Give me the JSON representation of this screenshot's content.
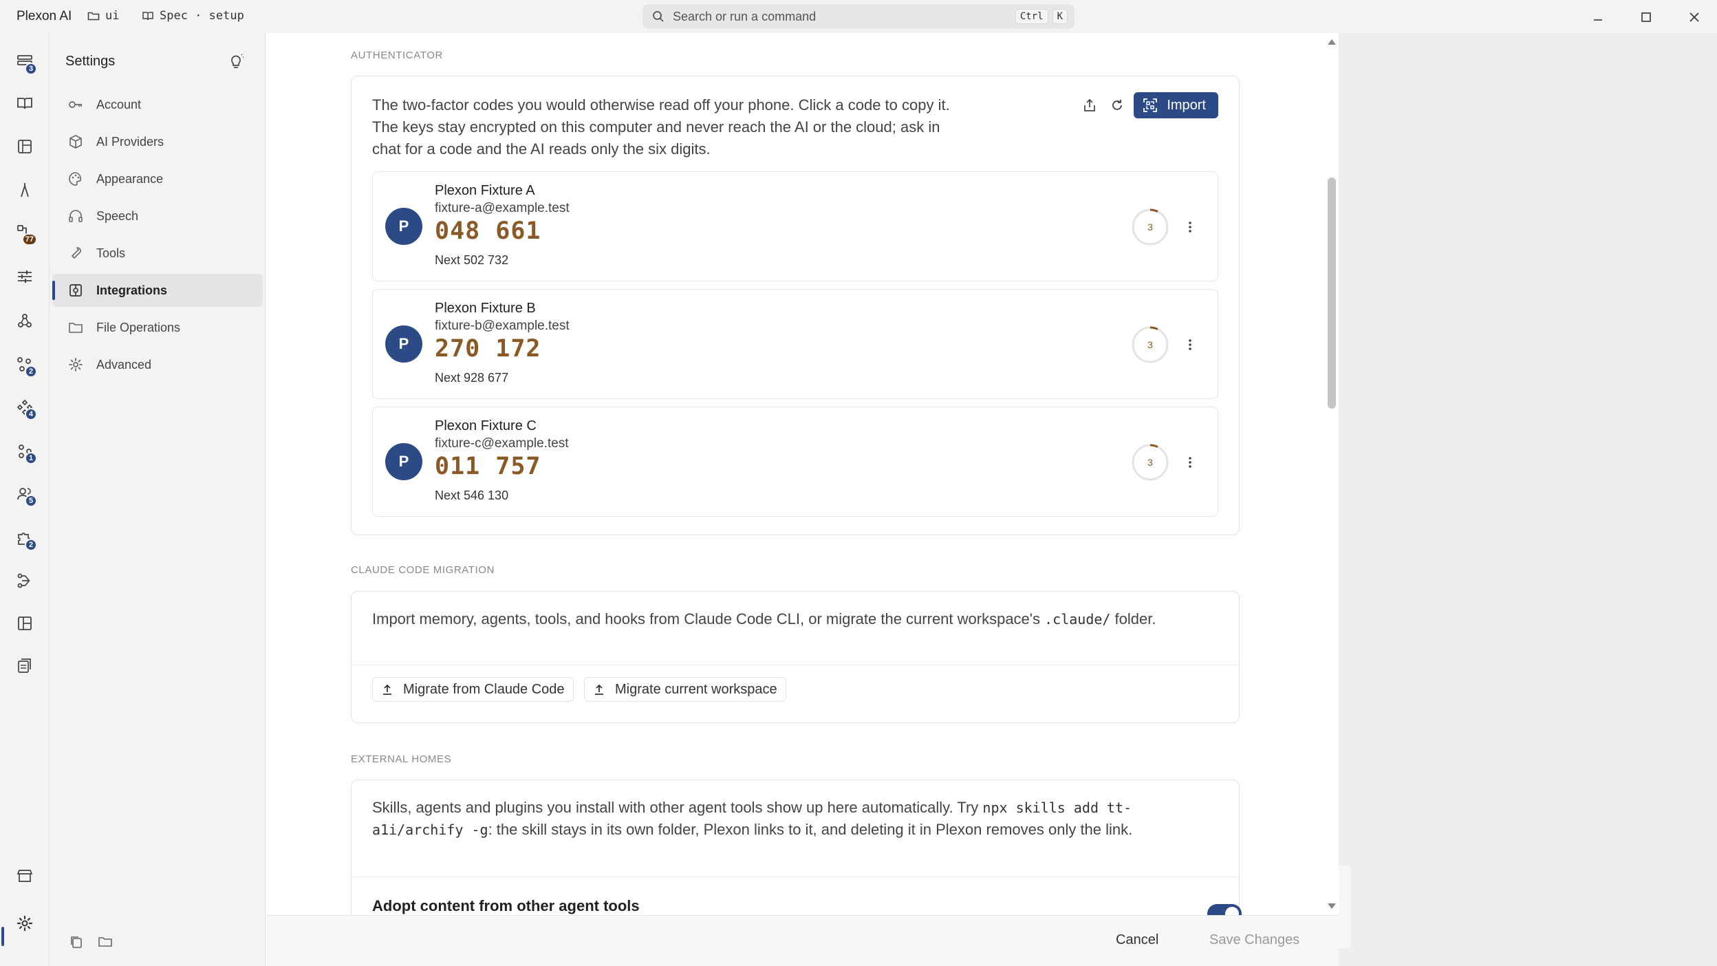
{
  "app": {
    "name": "Plexon AI",
    "crumb_folder": "ui",
    "crumb_spec": "Spec · setup"
  },
  "search": {
    "placeholder": "Search or run a command",
    "kbd1": "Ctrl",
    "kbd2": "K"
  },
  "activity": {
    "badges": [
      "3",
      "77",
      "2",
      "4",
      "1",
      "5",
      "2"
    ]
  },
  "sidebar": {
    "title": "Settings",
    "items": [
      {
        "label": "Account",
        "icon": "key-icon"
      },
      {
        "label": "AI Providers",
        "icon": "cube-icon"
      },
      {
        "label": "Appearance",
        "icon": "palette-icon"
      },
      {
        "label": "Speech",
        "icon": "headphones-icon"
      },
      {
        "label": "Tools",
        "icon": "wrench-icon"
      },
      {
        "label": "Integrations",
        "icon": "integrations-icon",
        "active": true
      },
      {
        "label": "File Operations",
        "icon": "folder-icon"
      },
      {
        "label": "Advanced",
        "icon": "gear-icon"
      }
    ]
  },
  "authenticator": {
    "label": "AUTHENTICATOR",
    "description": "The two-factor codes you would otherwise read off your phone. Click a code to copy it. The keys stay encrypted on this computer and never reach the AI or the cloud; ask in chat for a code and the AI reads only the six digits.",
    "import_label": "Import",
    "accounts": [
      {
        "initial": "P",
        "name": "Plexon Fixture A",
        "email": "fixture-a@example.test",
        "code": "048 661",
        "next": "Next 502 732",
        "seconds": "3"
      },
      {
        "initial": "P",
        "name": "Plexon Fixture B",
        "email": "fixture-b@example.test",
        "code": "270 172",
        "next": "Next 928 677",
        "seconds": "3"
      },
      {
        "initial": "P",
        "name": "Plexon Fixture C",
        "email": "fixture-c@example.test",
        "code": "011 757",
        "next": "Next 546 130",
        "seconds": "3"
      }
    ]
  },
  "migration": {
    "label": "CLAUDE CODE MIGRATION",
    "text_before": "Import memory, agents, tools, and hooks from Claude Code CLI, or migrate the current workspace's ",
    "text_code": ".claude/",
    "text_after": " folder.",
    "btn_migrate": "Migrate from Claude Code",
    "btn_workspace": "Migrate current workspace"
  },
  "external": {
    "label": "EXTERNAL HOMES",
    "text_before": "Skills, agents and plugins you install with other agent tools show up here automatically. Try ",
    "text_code": "npx skills add tt-a1i/archify -g",
    "text_after": ": the skill stays in its own folder, Plexon links to it, and deleting it in Plexon removes only the link.",
    "adopt_label": "Adopt content from other agent tools",
    "adopt_enabled": true
  },
  "footer": {
    "cancel": "Cancel",
    "save": "Save Changes"
  },
  "colors": {
    "accent": "#2c4a86",
    "code": "#8a5a26"
  }
}
